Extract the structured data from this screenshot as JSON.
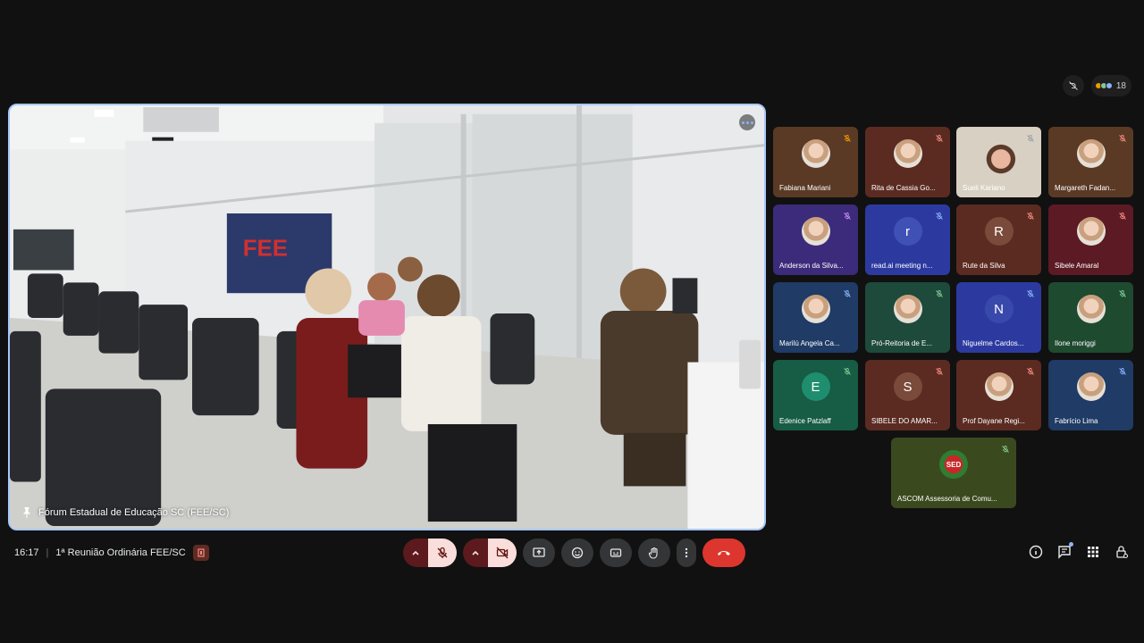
{
  "meeting": {
    "time": "16:17",
    "title": "1ª Reunião Ordinária FEE/SC",
    "participant_count": "18"
  },
  "main_video": {
    "name": "Fórum Estadual de Educação SC (FEE/SC)",
    "banner_text": "FEE",
    "pinned": true
  },
  "participants": [
    {
      "name": "Fabiana Mariani",
      "bg": "#5a3a25",
      "avatar": "photo",
      "muted": true,
      "mic_color": "#f29900"
    },
    {
      "name": "Rita de Cassia Go...",
      "bg": "#5b2b22",
      "avatar": "photo",
      "muted": true,
      "mic_color": "#f28b82"
    },
    {
      "name": "Sueli Kariano",
      "bg": "#cfc6b8",
      "avatar": "video",
      "muted": true,
      "mic_color": "#9aa0a6"
    },
    {
      "name": "Margareth Fadan...",
      "bg": "#5a3a25",
      "avatar": "photo",
      "muted": true,
      "mic_color": "#f28b82"
    },
    {
      "name": "Anderson da Silva...",
      "bg": "#3b2b7a",
      "avatar": "photo",
      "muted": true,
      "mic_color": "#c58af9"
    },
    {
      "name": "read.ai meeting n...",
      "bg": "#2c3aa0",
      "avatar": "r",
      "avatar_bg": "#3f51b5",
      "muted": true,
      "mic_color": "#8ab4f8"
    },
    {
      "name": "Rute da Silva",
      "bg": "#5b2b22",
      "avatar": "R",
      "avatar_bg": "#7a4a3a",
      "muted": true,
      "mic_color": "#f28b82"
    },
    {
      "name": "Sibele Amaral",
      "bg": "#5c1a24",
      "avatar": "photo",
      "muted": true,
      "mic_color": "#f28b82"
    },
    {
      "name": "Marilú Angela Ca...",
      "bg": "#1f3b66",
      "avatar": "photo",
      "muted": true,
      "mic_color": "#8ab4f8"
    },
    {
      "name": "Pró-Reitoria de E...",
      "bg": "#1e4a3c",
      "avatar": "photo",
      "muted": true,
      "mic_color": "#81c995"
    },
    {
      "name": "Niguelme Cardos...",
      "bg": "#2c3aa0",
      "avatar": "N",
      "avatar_bg": "#3949ab",
      "muted": true,
      "mic_color": "#8ab4f8"
    },
    {
      "name": "Ilone moriggi",
      "bg": "#1e4a30",
      "avatar": "photo",
      "muted": true,
      "mic_color": "#81c995"
    },
    {
      "name": "Edenice Patzlaff",
      "bg": "#175c45",
      "avatar": "E",
      "avatar_bg": "#1e8e6e",
      "muted": true,
      "mic_color": "#81c995"
    },
    {
      "name": "SIBELE DO AMAR...",
      "bg": "#5b2b22",
      "avatar": "S",
      "avatar_bg": "#7a4a3a",
      "muted": true,
      "mic_color": "#f28b82"
    },
    {
      "name": "Prof Dayane Regi...",
      "bg": "#5b2b22",
      "avatar": "photo",
      "muted": true,
      "mic_color": "#f28b82"
    },
    {
      "name": "Fabrício Lima",
      "bg": "#1f3b66",
      "avatar": "photo",
      "muted": true,
      "mic_color": "#8ab4f8"
    },
    {
      "name": "ASCOM Assessoria de Comu...",
      "bg": "#3b4a1e",
      "avatar": "SED",
      "avatar_bg": "#2e7d32",
      "muted": true,
      "mic_color": "#81c995"
    }
  ],
  "colors": {
    "background": "#111111",
    "active_border": "#a8c7fa",
    "hangup": "#dc362e",
    "muted_control_bg": "#f9dedc"
  },
  "controls": {
    "mic_muted": true,
    "camera_off": true
  },
  "icons": {
    "right": [
      "info-icon",
      "chat-icon",
      "activities-icon",
      "host-controls-icon"
    ]
  }
}
